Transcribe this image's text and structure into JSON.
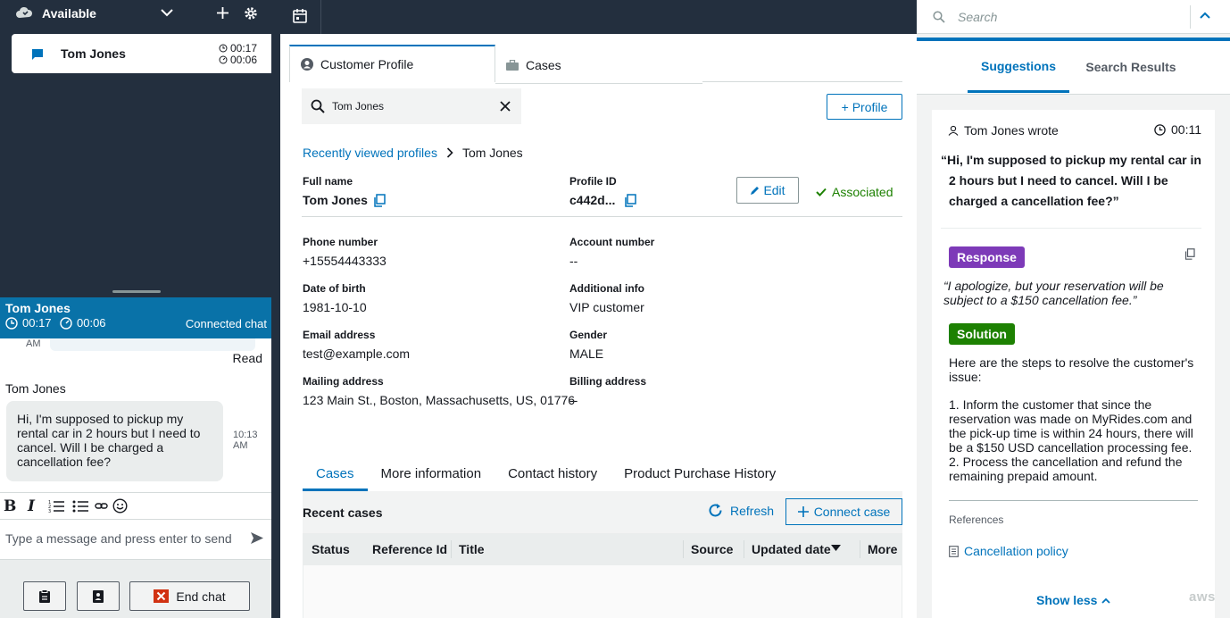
{
  "left_panel": {
    "status": "Available",
    "contact": {
      "name": "Tom Jones",
      "timer_total": "00:17",
      "timer_active": "00:06"
    },
    "chat": {
      "header_name": "Tom Jones",
      "timer_total": "00:17",
      "timer_active": "00:06",
      "state": "Connected chat",
      "prev_time_suffix": "AM",
      "read_receipt": "Read",
      "sender": "Tom Jones",
      "message": "Hi, I'm supposed to pickup my rental car in 2 hours but I need to cancel. Will I be charged a cancellation fee?",
      "message_time": "10:13",
      "message_ampm": "AM",
      "input_placeholder": "Type a message and press enter to send",
      "end_chat_label": "End chat"
    }
  },
  "middle_panel": {
    "tabs": [
      {
        "label": "Customer Profile"
      },
      {
        "label": "Cases"
      }
    ],
    "search_value": "Tom Jones",
    "add_profile_label": "+ Profile",
    "breadcrumb": {
      "parent": "Recently viewed profiles",
      "current": "Tom Jones"
    },
    "full_name_label": "Full name",
    "full_name": "Tom Jones",
    "profile_id_label": "Profile ID",
    "profile_id": "c442d...",
    "edit_label": "Edit",
    "associated_label": "Associated",
    "fields": {
      "phone_label": "Phone number",
      "phone": "+15554443333",
      "account_label": "Account number",
      "account": "--",
      "dob_label": "Date of birth",
      "dob": "1981-10-10",
      "additional_label": "Additional info",
      "additional": "VIP customer",
      "email_label": "Email address",
      "email": "test@example.com",
      "gender_label": "Gender",
      "gender": "MALE",
      "mailing_label": "Mailing address",
      "mailing": "123 Main St., Boston, Massachusetts, US, 01776",
      "billing_label": "Billing address",
      "billing": "--"
    },
    "bottom_tabs": [
      "Cases",
      "More information",
      "Contact history",
      "Product Purchase History"
    ],
    "recent_cases_label": "Recent cases",
    "refresh_label": "Refresh",
    "connect_case_label": "Connect case",
    "table_columns": [
      "Status",
      "Reference Id",
      "Title",
      "Source",
      "Updated date",
      "More"
    ]
  },
  "right_panel": {
    "search_placeholder": "Search",
    "tabs": [
      "Suggestions",
      "Search Results"
    ],
    "wrote_label": "Tom Jones wrote",
    "wrote_time": "00:11",
    "quote": "“Hi, I'm supposed to pickup my rental car in 2 hours but I need to cancel. Will I be charged a cancellation fee?”",
    "response_badge": "Response",
    "response_text": "“I apologize, but your reservation will be subject to a $150 cancellation fee.”",
    "solution_badge": "Solution",
    "solution_intro": "Here are the steps to resolve the customer's issue:",
    "solution_step1": "1. Inform the customer that since the reservation was made on MyRides.com and the pick-up time is within 24 hours, there will be a $150 USD cancellation processing fee.",
    "solution_step2": "2. Process the cancellation and refund the remaining prepaid amount.",
    "references_label": "References",
    "reference_link": "Cancellation policy",
    "show_less_label": "Show less",
    "watermark": "aws"
  },
  "colors": {
    "navy": "#232f3e",
    "blue": "#0073bb",
    "chat_header": "#0972a8",
    "response_badge": "#7d3ab8",
    "solution_badge": "#1d8102",
    "end_chat_icon": "#d13212"
  }
}
